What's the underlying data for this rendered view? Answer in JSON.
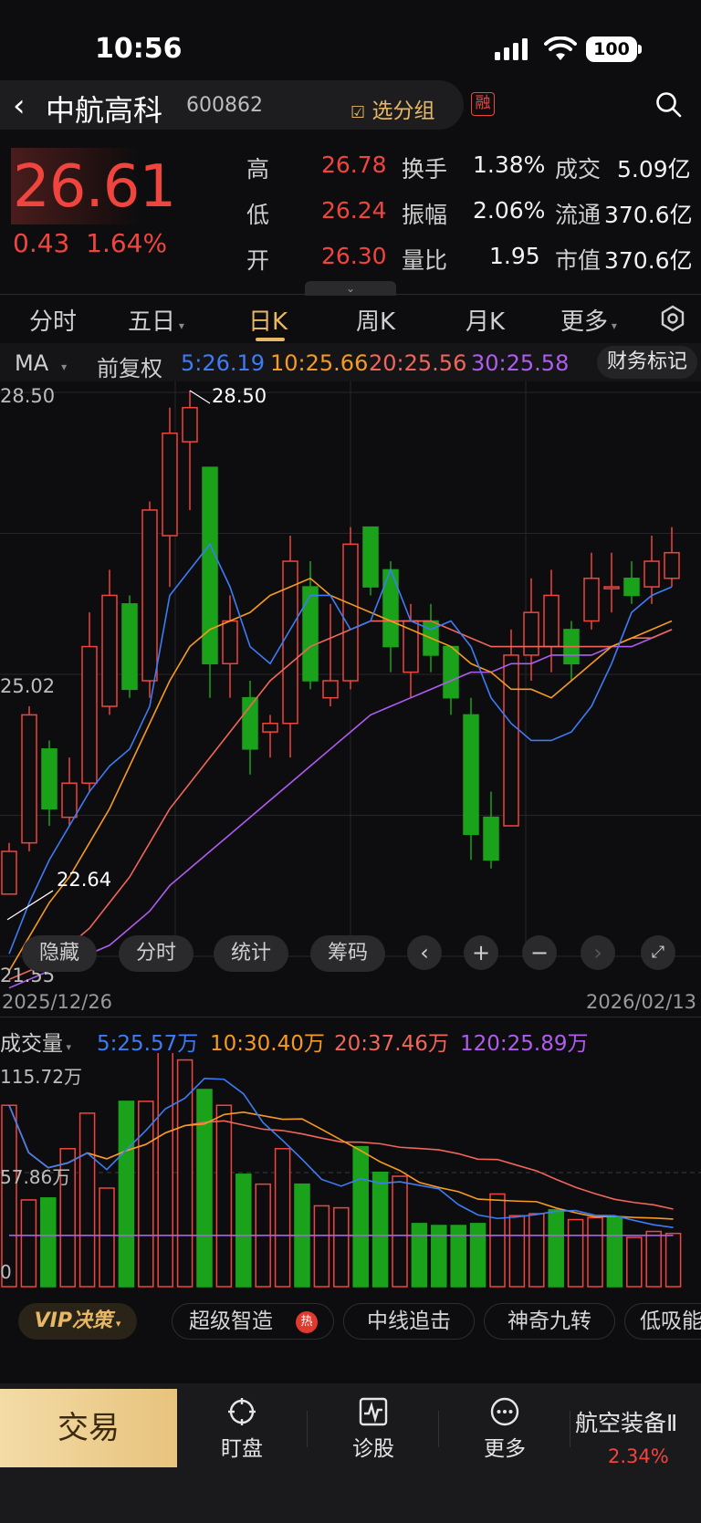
{
  "status_bar": {
    "time": "10:56",
    "battery": "100"
  },
  "header": {
    "back_icon": "chevron-left-icon",
    "stock_name": "中航高科",
    "stock_code": "600862",
    "group_button": "选分组",
    "margin_badge": "融",
    "search_icon": "search-icon"
  },
  "quote": {
    "price": "26.61",
    "change": "0.43",
    "change_pct": "1.64%",
    "high_label": "高",
    "high": "26.78",
    "low_label": "低",
    "low": "26.24",
    "open_label": "开",
    "open": "26.30",
    "turnover_label": "换手",
    "turnover": "1.38%",
    "amplitude_label": "振幅",
    "amplitude": "2.06%",
    "vol_ratio_label": "量比",
    "vol_ratio": "1.95",
    "amount_label": "成交",
    "amount": "5.09亿",
    "float_label": "流通",
    "float_cap": "370.6亿",
    "mktcap_label": "市值",
    "mkt_cap": "370.6亿",
    "colors": {
      "up": "#f0453f",
      "down": "#1aa31a",
      "accent": "#e8b764"
    }
  },
  "tabs": [
    {
      "label": "分时"
    },
    {
      "label": "五日"
    },
    {
      "label": "日K",
      "active": true
    },
    {
      "label": "周K"
    },
    {
      "label": "月K"
    },
    {
      "label": "更多"
    }
  ],
  "ma_row": {
    "indicator": "MA",
    "adjust": "前复权",
    "ma5": "5:26.19",
    "ma10": "10:25.66",
    "ma20": "20:25.56",
    "ma30": "30:25.58",
    "finance_button": "财务标记",
    "colors": {
      "ma5": "#3d7cf5",
      "ma10": "#f59a23",
      "ma20": "#f0665a",
      "ma30": "#b05cf0"
    }
  },
  "chart_controls": {
    "hide": "隐藏",
    "intraday": "分时",
    "stats": "统计",
    "chips": "筹码"
  },
  "kline": {
    "y_top_label": "28.50",
    "y_mid_label": "25.02",
    "y_bottom_label": "21.55",
    "max_marker": "28.50",
    "min_marker": "22.64",
    "date_start": "2025/12/26",
    "date_end": "2026/02/13"
  },
  "chart_data": {
    "type": "candlestick",
    "ylim": [
      21.55,
      28.5
    ],
    "candles": [
      {
        "o": 22.6,
        "c": 23.1,
        "h": 23.2,
        "l": 22.6
      },
      {
        "o": 23.2,
        "c": 24.7,
        "h": 24.8,
        "l": 23.1
      },
      {
        "o": 24.3,
        "c": 23.6,
        "h": 24.4,
        "l": 23.4
      },
      {
        "o": 23.5,
        "c": 23.9,
        "h": 24.2,
        "l": 23.4
      },
      {
        "o": 23.9,
        "c": 25.5,
        "h": 25.9,
        "l": 23.8
      },
      {
        "o": 24.8,
        "c": 26.1,
        "h": 26.4,
        "l": 24.7
      },
      {
        "o": 26.0,
        "c": 25.0,
        "h": 26.1,
        "l": 24.9
      },
      {
        "o": 25.1,
        "c": 27.1,
        "h": 27.2,
        "l": 24.9
      },
      {
        "o": 26.8,
        "c": 28.0,
        "h": 28.3,
        "l": 26.2
      },
      {
        "o": 27.9,
        "c": 28.3,
        "h": 28.5,
        "l": 27.1
      },
      {
        "o": 27.6,
        "c": 25.3,
        "h": 27.6,
        "l": 24.9
      },
      {
        "o": 25.3,
        "c": 25.8,
        "h": 26.1,
        "l": 24.9
      },
      {
        "o": 24.9,
        "c": 24.3,
        "h": 25.1,
        "l": 24.0
      },
      {
        "o": 24.5,
        "c": 24.6,
        "h": 24.7,
        "l": 24.2
      },
      {
        "o": 24.6,
        "c": 26.5,
        "h": 26.8,
        "l": 24.2
      },
      {
        "o": 26.2,
        "c": 25.1,
        "h": 26.5,
        "l": 25.0
      },
      {
        "o": 24.9,
        "c": 25.1,
        "h": 26.0,
        "l": 24.8
      },
      {
        "o": 25.1,
        "c": 26.7,
        "h": 26.9,
        "l": 25.0
      },
      {
        "o": 26.9,
        "c": 26.2,
        "h": 26.9,
        "l": 26.1
      },
      {
        "o": 26.4,
        "c": 25.5,
        "h": 26.5,
        "l": 25.2
      },
      {
        "o": 25.2,
        "c": 25.8,
        "h": 26.0,
        "l": 24.9
      },
      {
        "o": 25.8,
        "c": 25.4,
        "h": 26.0,
        "l": 25.2
      },
      {
        "o": 25.5,
        "c": 24.9,
        "h": 25.5,
        "l": 24.7
      },
      {
        "o": 24.7,
        "c": 23.3,
        "h": 24.9,
        "l": 23.0
      },
      {
        "o": 23.5,
        "c": 23.0,
        "h": 23.8,
        "l": 22.9
      },
      {
        "o": 23.4,
        "c": 25.4,
        "h": 25.7,
        "l": 23.4
      },
      {
        "o": 25.4,
        "c": 25.9,
        "h": 26.3,
        "l": 25.1
      },
      {
        "o": 25.5,
        "c": 26.1,
        "h": 26.4,
        "l": 25.2
      },
      {
        "o": 25.7,
        "c": 25.3,
        "h": 25.8,
        "l": 25.1
      },
      {
        "o": 25.8,
        "c": 26.3,
        "h": 26.6,
        "l": 25.7
      },
      {
        "o": 26.2,
        "c": 26.2,
        "h": 26.6,
        "l": 25.9
      },
      {
        "o": 26.3,
        "c": 26.1,
        "h": 26.5,
        "l": 26.0
      },
      {
        "o": 26.2,
        "c": 26.5,
        "h": 26.8,
        "l": 26.0
      },
      {
        "o": 26.3,
        "c": 26.6,
        "h": 26.9,
        "l": 26.2
      }
    ],
    "ma5": [
      21.9,
      22.5,
      23.0,
      23.4,
      23.8,
      24.1,
      24.3,
      24.8,
      26.1,
      26.4,
      26.7,
      26.2,
      25.5,
      25.3,
      25.7,
      26.1,
      26.1,
      25.7,
      25.8,
      26.4,
      25.8,
      25.7,
      25.8,
      25.5,
      24.9,
      24.6,
      24.4,
      24.4,
      24.5,
      24.8,
      25.3,
      25.9,
      26.1,
      26.2
    ],
    "ma10": [
      21.7,
      22.1,
      22.5,
      22.8,
      23.2,
      23.6,
      24.1,
      24.6,
      25.1,
      25.5,
      25.7,
      25.8,
      25.9,
      26.1,
      26.2,
      26.3,
      26.1,
      26.0,
      25.9,
      25.8,
      25.7,
      25.6,
      25.5,
      25.3,
      25.2,
      25.0,
      25.0,
      24.9,
      25.1,
      25.3,
      25.5,
      25.6,
      25.7,
      25.8
    ],
    "ma20": [
      21.6,
      21.7,
      21.8,
      22.0,
      22.2,
      22.5,
      22.8,
      23.2,
      23.6,
      23.9,
      24.2,
      24.5,
      24.8,
      25.1,
      25.3,
      25.5,
      25.6,
      25.7,
      25.8,
      25.8,
      25.8,
      25.8,
      25.7,
      25.6,
      25.5,
      25.5,
      25.5,
      25.5,
      25.5,
      25.5,
      25.5,
      25.6,
      25.6,
      25.7
    ],
    "ma30": [
      21.5,
      21.6,
      21.7,
      21.8,
      21.9,
      22.0,
      22.2,
      22.4,
      22.7,
      22.9,
      23.1,
      23.3,
      23.5,
      23.7,
      23.9,
      24.1,
      24.3,
      24.5,
      24.7,
      24.8,
      24.9,
      25.0,
      25.1,
      25.2,
      25.2,
      25.3,
      25.3,
      25.4,
      25.4,
      25.4,
      25.5,
      25.5,
      25.6,
      25.7
    ],
    "volume": [
      92,
      44,
      45,
      70,
      88,
      50,
      94,
      94,
      125,
      115,
      100,
      92,
      57,
      52,
      70,
      52,
      41,
      40,
      71,
      58,
      56,
      32,
      31,
      31,
      32,
      47,
      36,
      37,
      39,
      34,
      35,
      35,
      25,
      28,
      27
    ],
    "volume_label": "成交量",
    "vol_ylim": [
      0,
      115.72
    ]
  },
  "volume_row": {
    "label": "成交量",
    "ma5": "5:25.57万",
    "ma10": "10:30.40万",
    "ma20": "20:37.46万",
    "ma120": "120:25.89万",
    "y_top": "115.72万",
    "y_mid": "57.86万",
    "y_zero": "0"
  },
  "strategies": {
    "vip": "VIP决策",
    "items": [
      "超级智造",
      "中线追击",
      "神奇九转",
      "低吸能"
    ],
    "hot_badge": "热"
  },
  "bottom_bar": {
    "trade": "交易",
    "watch": "盯盘",
    "diagnose": "诊股",
    "more": "更多",
    "sector": "航空装备Ⅱ",
    "sector_change": "2.34%"
  }
}
